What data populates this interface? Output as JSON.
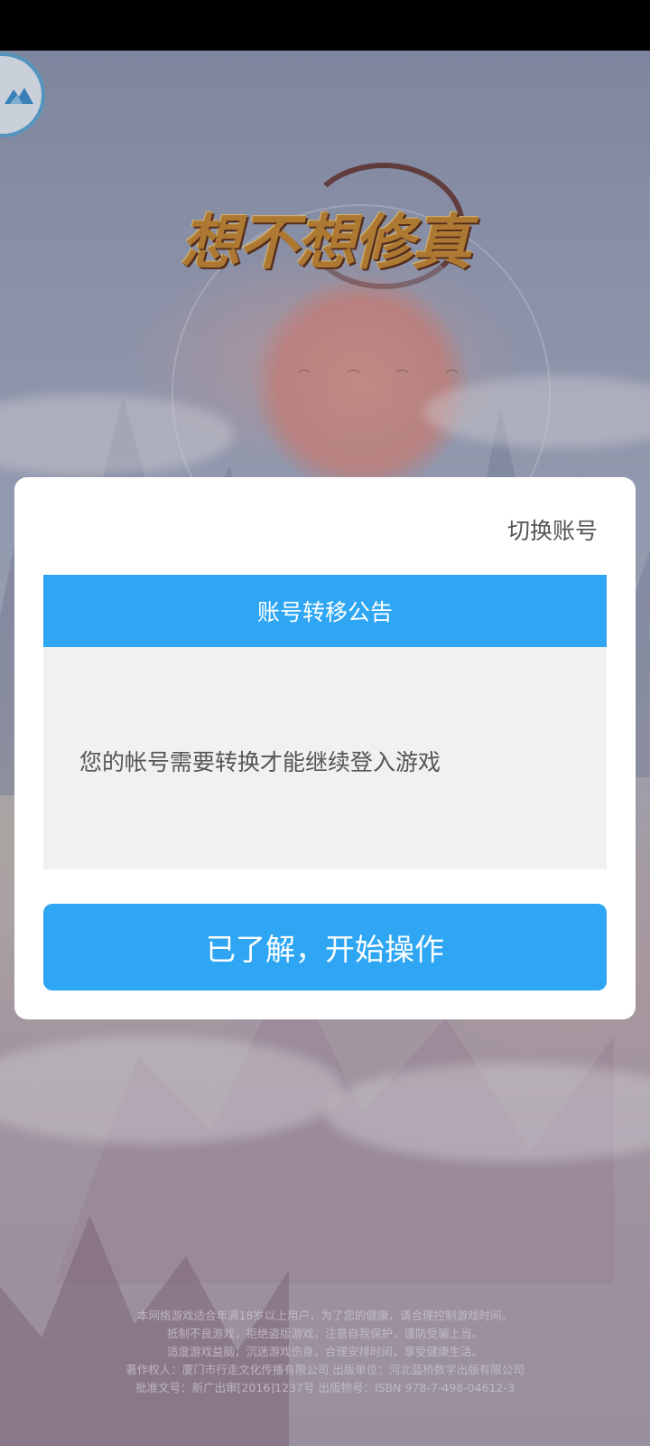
{
  "game": {
    "logo_text": "想不想修真"
  },
  "dialog": {
    "switch_account_label": "切换账号",
    "notice_title": "账号转移公告",
    "notice_message": "您的帐号需要转换才能继续登入游戏",
    "confirm_label": "已了解，开始操作"
  },
  "footer": {
    "lines": [
      "本网络游戏适合年满18岁以上用户，为了您的健康，请合理控制游戏时间。",
      "抵制不良游戏，拒绝盗版游戏，注意自我保护，谨防受骗上当。",
      "适度游戏益脑，沉迷游戏伤身，合理安排时间，享受健康生活。",
      "著作权人：厦门市行走文化传播有限公司  出版单位：河北蓝桥数字出版有限公司",
      "批准文号：新广出审[2016]1237号 出版物号：ISBN 978-7-498-04612-3"
    ]
  },
  "colors": {
    "accent": "#2ea6f3",
    "dialog_bg": "#ffffff",
    "notice_body_bg": "#f1f1f1",
    "text_gray": "#555555"
  },
  "icons": {
    "corner_logo": "mountain-logo-icon"
  }
}
